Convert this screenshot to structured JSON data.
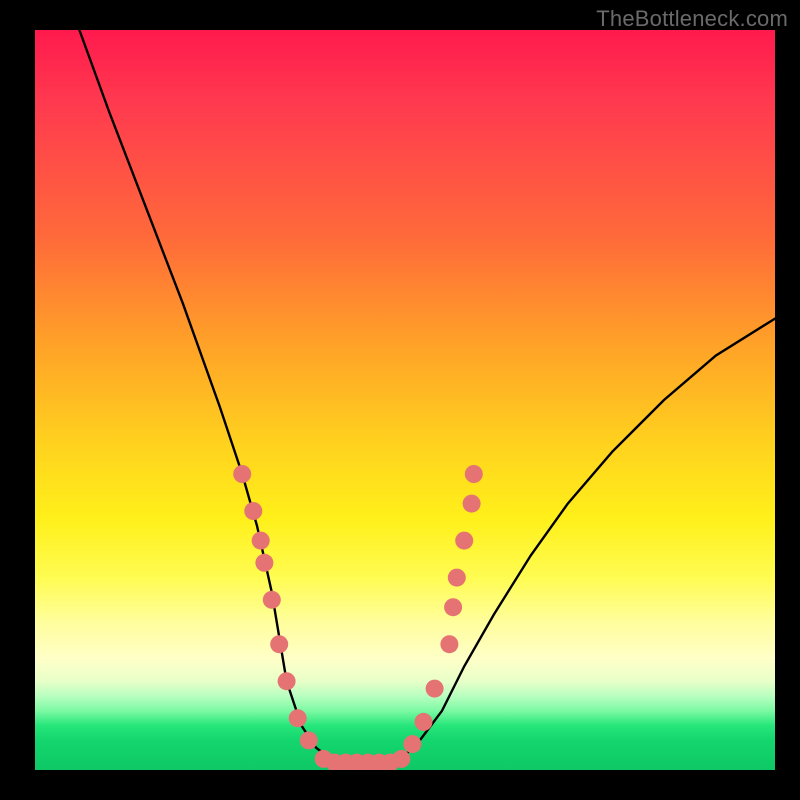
{
  "watermark": "TheBottleneck.com",
  "chart_data": {
    "type": "line",
    "title": "",
    "xlabel": "",
    "ylabel": "",
    "xlim": [
      0,
      100
    ],
    "ylim": [
      0,
      100
    ],
    "series": [
      {
        "name": "bottleneck-curve",
        "x": [
          6,
          10,
          15,
          20,
          25,
          28,
          30,
          32,
          33,
          34,
          36,
          38,
          40,
          42,
          44,
          46,
          48,
          50,
          52,
          55,
          58,
          62,
          67,
          72,
          78,
          85,
          92,
          100
        ],
        "y": [
          100,
          89,
          76,
          63,
          49,
          40,
          33,
          24,
          18,
          12,
          6,
          3,
          1.5,
          1,
          1,
          1,
          1.2,
          2,
          4,
          8,
          14,
          21,
          29,
          36,
          43,
          50,
          56,
          61
        ]
      }
    ],
    "scatter": {
      "name": "data-points",
      "color": "#e57373",
      "points": [
        {
          "x": 28.0,
          "y": 40.0
        },
        {
          "x": 29.5,
          "y": 35.0
        },
        {
          "x": 30.5,
          "y": 31.0
        },
        {
          "x": 31.0,
          "y": 28.0
        },
        {
          "x": 32.0,
          "y": 23.0
        },
        {
          "x": 33.0,
          "y": 17.0
        },
        {
          "x": 34.0,
          "y": 12.0
        },
        {
          "x": 35.5,
          "y": 7.0
        },
        {
          "x": 37.0,
          "y": 4.0
        },
        {
          "x": 39.0,
          "y": 1.5
        },
        {
          "x": 40.5,
          "y": 1.0
        },
        {
          "x": 42.0,
          "y": 1.0
        },
        {
          "x": 43.5,
          "y": 1.0
        },
        {
          "x": 45.0,
          "y": 1.0
        },
        {
          "x": 46.5,
          "y": 1.0
        },
        {
          "x": 48.0,
          "y": 1.0
        },
        {
          "x": 49.5,
          "y": 1.5
        },
        {
          "x": 51.0,
          "y": 3.5
        },
        {
          "x": 52.5,
          "y": 6.5
        },
        {
          "x": 54.0,
          "y": 11.0
        },
        {
          "x": 56.0,
          "y": 17.0
        },
        {
          "x": 56.5,
          "y": 22.0
        },
        {
          "x": 57.0,
          "y": 26.0
        },
        {
          "x": 58.0,
          "y": 31.0
        },
        {
          "x": 59.0,
          "y": 36.0
        },
        {
          "x": 59.3,
          "y": 40.0
        }
      ]
    },
    "gradient_stops": [
      {
        "pos": 0,
        "color": "#ff1a4d"
      },
      {
        "pos": 28,
        "color": "#ff6a3a"
      },
      {
        "pos": 56,
        "color": "#ffd21e"
      },
      {
        "pos": 80,
        "color": "#fffe9c"
      },
      {
        "pos": 92,
        "color": "#7cf9a3"
      },
      {
        "pos": 100,
        "color": "#0ec865"
      }
    ]
  }
}
